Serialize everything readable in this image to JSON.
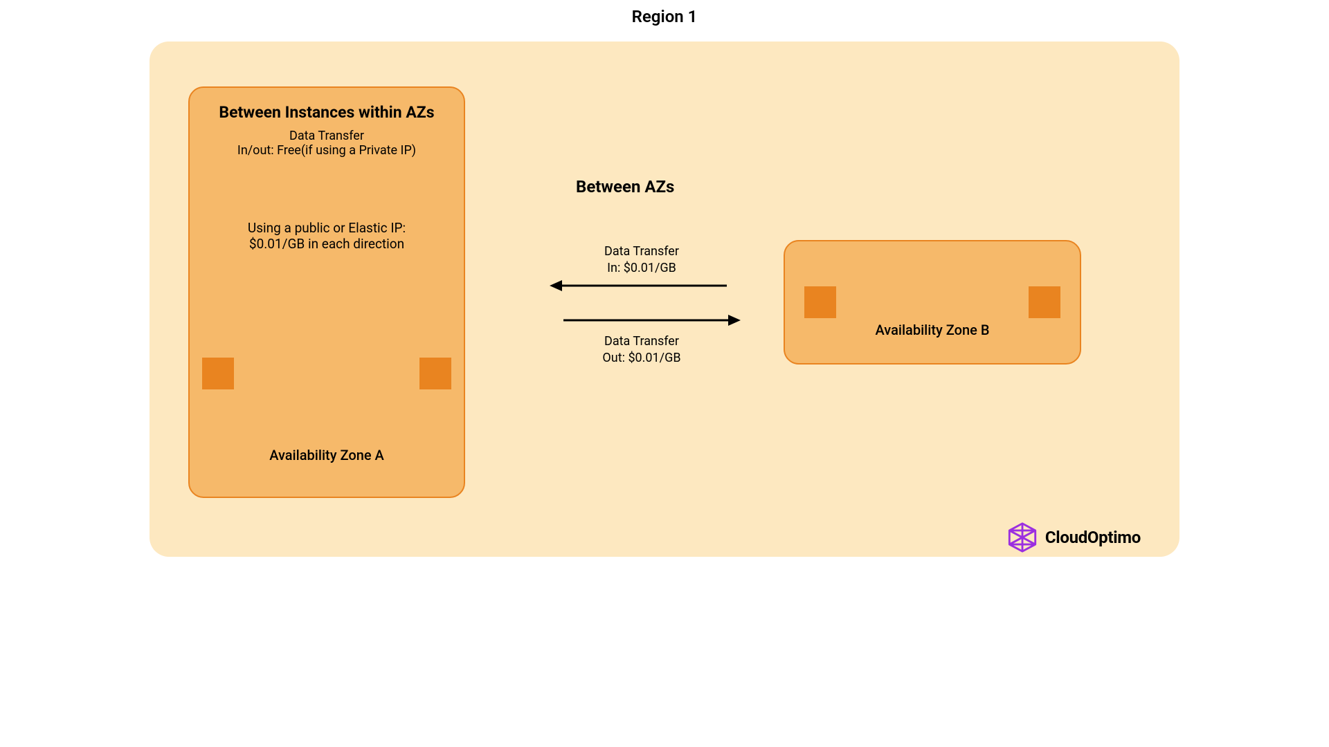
{
  "region": {
    "title": "Region 1"
  },
  "zoneA": {
    "heading": "Between Instances within AZs",
    "data_line1": "Data Transfer",
    "data_line2": "In/out: Free(if using a Private IP)",
    "public_line1": "Using a public or Elastic IP:",
    "public_line2": "$0.01/GB in each direction",
    "label": "Availability Zone A"
  },
  "zoneB": {
    "label": "Availability Zone B"
  },
  "betweenAZ": {
    "title": "Between AZs",
    "in_line1": "Data Transfer",
    "in_line2": "In: $0.01/GB",
    "out_line1": "Data Transfer",
    "out_line2": "Out: $0.01/GB"
  },
  "brand": {
    "name": "CloudOptimo"
  },
  "colors": {
    "region_bg": "#fde8c0",
    "zone_bg": "#f6b96a",
    "zone_border": "#e98420",
    "logo_purple": "#9b2fe0"
  }
}
